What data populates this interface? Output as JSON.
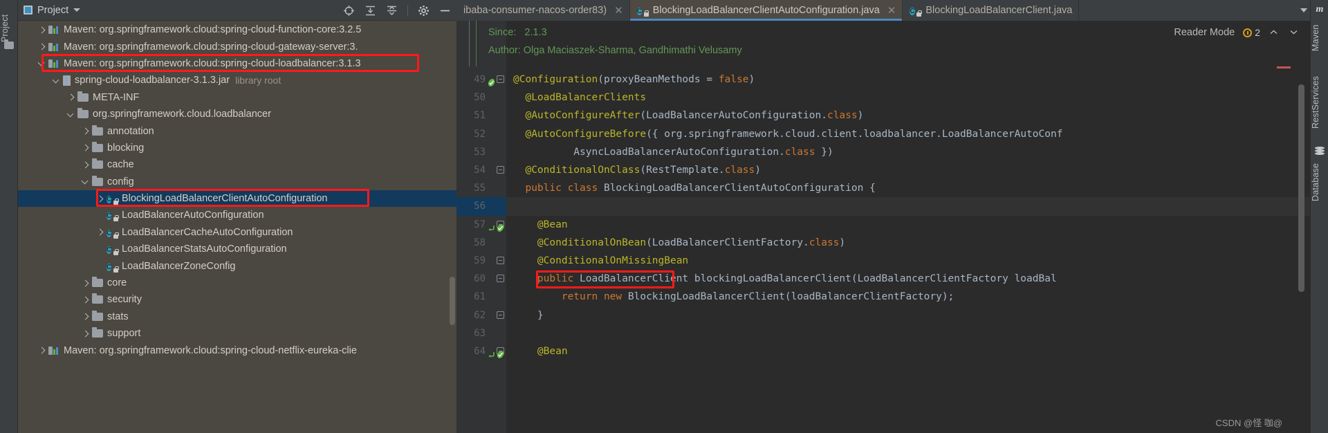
{
  "left_strip": {
    "project_label": "Project",
    "folder_icon": "folder-icon"
  },
  "right_strip": {
    "maven_icon": "maven-m-icon",
    "items": [
      "Maven",
      "RestServices",
      "Database"
    ]
  },
  "project_panel": {
    "title": "Project",
    "dropdown_icon": "chevron-down-icon",
    "toolbar_icons": [
      "locate-target-icon",
      "expand-all-icon",
      "collapse-all-icon",
      "gear-icon",
      "hide-icon"
    ],
    "tree": [
      {
        "indent": 0,
        "arrow": "right",
        "icon": "maven-icon",
        "label": "Maven: org.springframework.cloud:spring-cloud-function-core:3.2.5",
        "selected": false
      },
      {
        "indent": 0,
        "arrow": "right",
        "icon": "maven-icon",
        "label": "Maven: org.springframework.cloud:spring-cloud-gateway-server:3.",
        "selected": false
      },
      {
        "indent": 0,
        "arrow": "down",
        "icon": "maven-icon",
        "label": "Maven: org.springframework.cloud:spring-cloud-loadbalancer:3.1.3",
        "selected": false,
        "boxed": true
      },
      {
        "indent": 1,
        "arrow": "down",
        "icon": "jar-icon",
        "label": "spring-cloud-loadbalancer-3.1.3.jar",
        "dim": "library root",
        "selected": false
      },
      {
        "indent": 2,
        "arrow": "right",
        "icon": "folder-icon",
        "label": "META-INF",
        "selected": false
      },
      {
        "indent": 2,
        "arrow": "down",
        "icon": "folder-icon",
        "label": "org.springframework.cloud.loadbalancer",
        "selected": false
      },
      {
        "indent": 3,
        "arrow": "right",
        "icon": "folder-icon",
        "label": "annotation",
        "selected": false
      },
      {
        "indent": 3,
        "arrow": "right",
        "icon": "folder-icon",
        "label": "blocking",
        "selected": false
      },
      {
        "indent": 3,
        "arrow": "right",
        "icon": "folder-icon",
        "label": "cache",
        "selected": false
      },
      {
        "indent": 3,
        "arrow": "down",
        "icon": "folder-icon",
        "label": "config",
        "selected": false
      },
      {
        "indent": 4,
        "arrow": "right",
        "icon": "class-icon",
        "label": "BlockingLoadBalancerClientAutoConfiguration",
        "selected": true,
        "boxed": true
      },
      {
        "indent": 4,
        "arrow": "none",
        "icon": "class-icon",
        "label": "LoadBalancerAutoConfiguration",
        "selected": false
      },
      {
        "indent": 4,
        "arrow": "right",
        "icon": "class-icon",
        "label": "LoadBalancerCacheAutoConfiguration",
        "selected": false
      },
      {
        "indent": 4,
        "arrow": "none",
        "icon": "class-icon",
        "label": "LoadBalancerStatsAutoConfiguration",
        "selected": false
      },
      {
        "indent": 4,
        "arrow": "none",
        "icon": "class-icon",
        "label": "LoadBalancerZoneConfig",
        "selected": false
      },
      {
        "indent": 3,
        "arrow": "right",
        "icon": "folder-icon",
        "label": "core",
        "selected": false
      },
      {
        "indent": 3,
        "arrow": "right",
        "icon": "folder-icon",
        "label": "security",
        "selected": false
      },
      {
        "indent": 3,
        "arrow": "right",
        "icon": "folder-icon",
        "label": "stats",
        "selected": false
      },
      {
        "indent": 3,
        "arrow": "right",
        "icon": "folder-icon",
        "label": "support",
        "selected": false
      },
      {
        "indent": 0,
        "arrow": "right",
        "icon": "maven-icon",
        "label": "Maven: org.springframework.cloud:spring-cloud-netflix-eureka-clie",
        "selected": false
      }
    ]
  },
  "editor": {
    "tabs": [
      {
        "label": "ibaba-consumer-nacos-order83)",
        "icon": "none",
        "active": false,
        "close_icon": "close-icon"
      },
      {
        "label": "BlockingLoadBalancerClientAutoConfiguration.java",
        "icon": "class-icon",
        "active": true,
        "close_icon": "close-icon"
      },
      {
        "label": "BlockingLoadBalancerClient.java",
        "icon": "class-icon",
        "active": false,
        "close_icon": "none"
      }
    ],
    "tab_overflow_icon": "chevron-down-icon",
    "reader_mode_label": "Reader Mode",
    "warning_count": "2",
    "warning_icon": "warning-icon",
    "nav_up_icon": "chevron-up-icon",
    "nav_down_icon": "chevron-down-icon",
    "javadoc": [
      {
        "label": "Since:",
        "value": "2.1.3"
      },
      {
        "label": "Author:",
        "value": "Olga Maciaszek-Sharma, Gandhimathi Velusamy"
      }
    ],
    "lines": [
      {
        "num": "49",
        "tokens": [
          {
            "t": "@Configuration",
            "c": "ann"
          },
          {
            "t": "(proxyBeanMethods = ",
            "c": "plain"
          },
          {
            "t": "false",
            "c": "k"
          },
          {
            "t": ")",
            "c": "plain"
          }
        ],
        "fold": true,
        "marks": [
          "green-check-icon"
        ]
      },
      {
        "num": "50",
        "tokens": [
          {
            "t": "  ",
            "c": "plain"
          },
          {
            "t": "@LoadBalancerClients",
            "c": "ann"
          }
        ]
      },
      {
        "num": "51",
        "tokens": [
          {
            "t": "  ",
            "c": "plain"
          },
          {
            "t": "@AutoConfigureAfter",
            "c": "ann"
          },
          {
            "t": "(LoadBalancerAutoConfiguration.",
            "c": "plain"
          },
          {
            "t": "class",
            "c": "k"
          },
          {
            "t": ")",
            "c": "plain"
          }
        ]
      },
      {
        "num": "52",
        "tokens": [
          {
            "t": "  ",
            "c": "plain"
          },
          {
            "t": "@AutoConfigureBefore",
            "c": "ann"
          },
          {
            "t": "({ org.springframework.cloud.client.loadbalancer.LoadBalancerAutoConf",
            "c": "plain"
          }
        ]
      },
      {
        "num": "53",
        "tokens": [
          {
            "t": "          AsyncLoadBalancerAutoConfiguration.",
            "c": "plain"
          },
          {
            "t": "class",
            "c": "k"
          },
          {
            "t": " })",
            "c": "plain"
          }
        ]
      },
      {
        "num": "54",
        "tokens": [
          {
            "t": "  ",
            "c": "plain"
          },
          {
            "t": "@ConditionalOnClass",
            "c": "ann"
          },
          {
            "t": "(RestTemplate.",
            "c": "plain"
          },
          {
            "t": "class",
            "c": "k"
          },
          {
            "t": ")",
            "c": "plain"
          }
        ],
        "fold": true
      },
      {
        "num": "55",
        "tokens": [
          {
            "t": "  ",
            "c": "plain"
          },
          {
            "t": "public class",
            "c": "k"
          },
          {
            "t": " BlockingLoadBalancerClientAutoConfiguration {",
            "c": "plain"
          }
        ]
      },
      {
        "num": "56",
        "tokens": [],
        "caret": true
      },
      {
        "num": "57",
        "tokens": [
          {
            "t": "    ",
            "c": "plain"
          },
          {
            "t": "@Bean",
            "c": "ann"
          }
        ],
        "fold": true,
        "marks": [
          "override-icon",
          "green-check-icon"
        ]
      },
      {
        "num": "58",
        "tokens": [
          {
            "t": "    ",
            "c": "plain"
          },
          {
            "t": "@ConditionalOnBean",
            "c": "ann"
          },
          {
            "t": "(LoadBalancerClientFactory.",
            "c": "plain"
          },
          {
            "t": "class",
            "c": "k"
          },
          {
            "t": ")",
            "c": "plain"
          }
        ]
      },
      {
        "num": "59",
        "tokens": [
          {
            "t": "    ",
            "c": "plain"
          },
          {
            "t": "@ConditionalOnMissingBean",
            "c": "ann"
          }
        ],
        "fold": true
      },
      {
        "num": "60",
        "tokens": [
          {
            "t": "    ",
            "c": "plain"
          },
          {
            "t": "public ",
            "c": "k"
          },
          {
            "t": "LoadBalancerClient",
            "c": "plain"
          },
          {
            "t": " blockingLoadBalancerClient(LoadBalancerClientFactory loadBal",
            "c": "plain"
          }
        ],
        "fold": true,
        "boxed_token": "LoadBalancerClient"
      },
      {
        "num": "61",
        "tokens": [
          {
            "t": "        ",
            "c": "plain"
          },
          {
            "t": "return new",
            "c": "k"
          },
          {
            "t": " BlockingLoadBalancerClient(loadBalancerClientFactory);",
            "c": "plain"
          }
        ]
      },
      {
        "num": "62",
        "tokens": [
          {
            "t": "    }",
            "c": "plain"
          }
        ],
        "fold": true
      },
      {
        "num": "63",
        "tokens": []
      },
      {
        "num": "64",
        "tokens": [
          {
            "t": "    ",
            "c": "plain"
          },
          {
            "t": "@Bean",
            "c": "ann"
          }
        ],
        "fold": true,
        "marks": [
          "override-icon",
          "green-check-icon"
        ]
      }
    ]
  },
  "watermark": "CSDN @怪 咖@",
  "colors": {
    "annotation_box": "#ff1a1a",
    "selection": "#123a5c",
    "tab_active_underline": "#4a88c7",
    "keyword": "#cc7832",
    "annotation": "#bbb529",
    "javadoc": "#629755",
    "identifier": "#a9b7c6"
  }
}
